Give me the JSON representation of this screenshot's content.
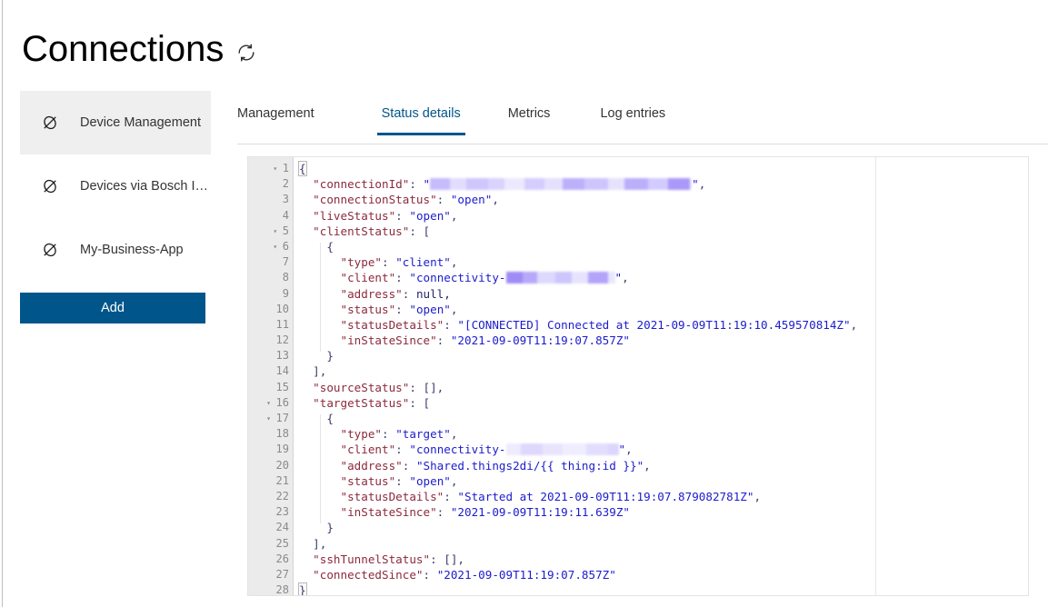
{
  "header": {
    "title": "Connections",
    "refresh_icon": "refresh-icon"
  },
  "sidebar": {
    "items": [
      {
        "label": "Device Management",
        "icon": "connection-icon",
        "active": true
      },
      {
        "label": "Devices via Bosch Io...",
        "icon": "connection-icon",
        "active": false
      },
      {
        "label": "My-Business-App",
        "icon": "connection-icon",
        "active": false
      }
    ],
    "add_button": "Add"
  },
  "tabs": [
    {
      "label": "Management",
      "active": false
    },
    {
      "label": "Status details",
      "active": true
    },
    {
      "label": "Metrics",
      "active": false
    },
    {
      "label": "Log entries",
      "active": false
    }
  ],
  "colors": {
    "brand_blue": "#00558b",
    "active_tab_underline": "#00558b",
    "sidebar_active_bg": "#efefef",
    "gutter_bg": "#ebebeb",
    "json_key": "#8b2a3d",
    "json_string": "#1c1ccc",
    "json_punct": "#3b3b6b",
    "redaction": "#c6bcfb"
  },
  "editor": {
    "total_lines": 28,
    "fold_lines": [
      1,
      5,
      6,
      16,
      17
    ],
    "lines": [
      {
        "num": 1,
        "text": "{"
      },
      {
        "num": 2,
        "text": "  \"connectionId\": \"[REDACTED]\","
      },
      {
        "num": 3,
        "text": "  \"connectionStatus\": \"open\","
      },
      {
        "num": 4,
        "text": "  \"liveStatus\": \"open\","
      },
      {
        "num": 5,
        "text": "  \"clientStatus\": ["
      },
      {
        "num": 6,
        "text": "    {"
      },
      {
        "num": 7,
        "text": "      \"type\": \"client\","
      },
      {
        "num": 8,
        "text": "      \"client\": \"connectivity-[REDACTED]\","
      },
      {
        "num": 9,
        "text": "      \"address\": null,"
      },
      {
        "num": 10,
        "text": "      \"status\": \"open\","
      },
      {
        "num": 11,
        "text": "      \"statusDetails\": \"[CONNECTED] Connected at 2021-09-09T11:19:10.459570814Z\","
      },
      {
        "num": 12,
        "text": "      \"inStateSince\": \"2021-09-09T11:19:07.857Z\""
      },
      {
        "num": 13,
        "text": "    }"
      },
      {
        "num": 14,
        "text": "  ],"
      },
      {
        "num": 15,
        "text": "  \"sourceStatus\": [],"
      },
      {
        "num": 16,
        "text": "  \"targetStatus\": ["
      },
      {
        "num": 17,
        "text": "    {"
      },
      {
        "num": 18,
        "text": "      \"type\": \"target\","
      },
      {
        "num": 19,
        "text": "      \"client\": \"connectivity-[REDACTED]\","
      },
      {
        "num": 20,
        "text": "      \"address\": \"Shared.things2di/{{ thing:id }}\","
      },
      {
        "num": 21,
        "text": "      \"status\": \"open\","
      },
      {
        "num": 22,
        "text": "      \"statusDetails\": \"Started at 2021-09-09T11:19:07.879082781Z\","
      },
      {
        "num": 23,
        "text": "      \"inStateSince\": \"2021-09-09T11:19:11.639Z\""
      },
      {
        "num": 24,
        "text": "    }"
      },
      {
        "num": 25,
        "text": "  ],"
      },
      {
        "num": 26,
        "text": "  \"sshTunnelStatus\": [],"
      },
      {
        "num": 27,
        "text": "  \"connectedSince\": \"2021-09-09T11:19:07.857Z\""
      },
      {
        "num": 28,
        "text": "}"
      }
    ],
    "tokens": {
      "brace_open": "{",
      "brace_close": "}",
      "bracket_open": "[",
      "bracket_close": "]",
      "comma": ",",
      "colon": ":",
      "empty_array": "[],",
      "array_close_comma": "],",
      "null_literal": "null,",
      "quote": "\"",
      "k_connectionId": "\"connectionId\"",
      "k_connectionStatus": "\"connectionStatus\"",
      "k_liveStatus": "\"liveStatus\"",
      "k_clientStatus": "\"clientStatus\"",
      "k_type": "\"type\"",
      "k_client": "\"client\"",
      "k_address": "\"address\"",
      "k_status": "\"status\"",
      "k_statusDetails": "\"statusDetails\"",
      "k_inStateSince": "\"inStateSince\"",
      "k_sourceStatus": "\"sourceStatus\"",
      "k_targetStatus": "\"targetStatus\"",
      "k_sshTunnelStatus": "\"sshTunnelStatus\"",
      "k_connectedSince": "\"connectedSince\"",
      "v_open": "\"open\"",
      "v_client": "\"client\"",
      "v_target": "\"target\"",
      "v_conn_prefix": "\"connectivity-",
      "v_quote_close": "\"",
      "v_statusDetails_client": "\"[CONNECTED] Connected at 2021-09-09T11:19:10.459570814Z\"",
      "v_inStateSince_client": "\"2021-09-09T11:19:07.857Z\"",
      "v_address_target": "\"Shared.things2di/{{ thing:id }}\"",
      "v_statusDetails_target": "\"Started at 2021-09-09T11:19:07.879082781Z\"",
      "v_inStateSince_target": "\"2021-09-09T11:19:11.639Z\"",
      "v_connectedSince": "\"2021-09-09T11:19:07.857Z\""
    },
    "line_numbers": [
      "1",
      "2",
      "3",
      "4",
      "5",
      "6",
      "7",
      "8",
      "9",
      "10",
      "11",
      "12",
      "13",
      "14",
      "15",
      "16",
      "17",
      "18",
      "19",
      "20",
      "21",
      "22",
      "23",
      "24",
      "25",
      "26",
      "27",
      "28"
    ],
    "fold_glyph": "▾"
  }
}
